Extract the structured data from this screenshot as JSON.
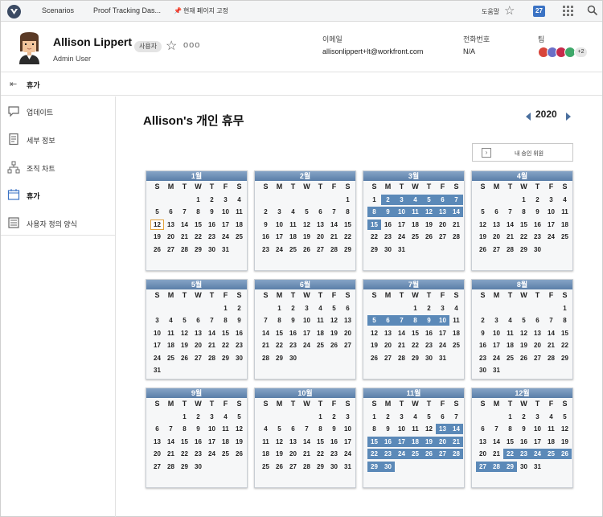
{
  "topbar": {
    "nav": [
      "Scenarios",
      "Proof Tracking Das...",
      "현재 페이지 고정"
    ],
    "help": "도움말",
    "badge": "27"
  },
  "user": {
    "name": "Allison Lippert",
    "role": "Admin User",
    "tag": "사용자",
    "more": "ooo"
  },
  "fields": [
    {
      "label": "이메일",
      "value": "allisonlippert+lt@workfront.com"
    },
    {
      "label": "전화번호",
      "value": "N/A"
    },
    {
      "label": "팀",
      "value": ""
    }
  ],
  "team": {
    "more": "+2",
    "colors": [
      "#d8453b",
      "#6b6fc7",
      "#c72a4b",
      "#3fa86a"
    ]
  },
  "breadcrumb": {
    "title": "휴가"
  },
  "sidebar": {
    "items": [
      {
        "label": "업데이트",
        "icon": "chat-icon"
      },
      {
        "label": "세부 정보",
        "icon": "document-icon"
      },
      {
        "label": "조직 차트",
        "icon": "org-chart-icon"
      },
      {
        "label": "휴가",
        "icon": "calendar-icon"
      },
      {
        "label": "사용자 정의 양식",
        "icon": "form-icon"
      }
    ]
  },
  "main": {
    "title": "Allison's 개인 휴무",
    "year": "2020",
    "approver": "내 승인 위원"
  },
  "calendar": {
    "dows": [
      "S",
      "M",
      "T",
      "W",
      "T",
      "F",
      "S"
    ],
    "months": [
      {
        "name": "1월",
        "start": 3,
        "days": 31,
        "off": [],
        "today": 12
      },
      {
        "name": "2월",
        "start": 6,
        "days": 29,
        "off": []
      },
      {
        "name": "3월",
        "start": 0,
        "days": 31,
        "off": [
          2,
          3,
          4,
          5,
          6,
          7,
          8,
          9,
          10,
          11,
          12,
          13,
          14,
          15
        ]
      },
      {
        "name": "4월",
        "start": 3,
        "days": 30,
        "off": []
      },
      {
        "name": "5월",
        "start": 5,
        "days": 31,
        "off": []
      },
      {
        "name": "6월",
        "start": 1,
        "days": 30,
        "off": []
      },
      {
        "name": "7월",
        "start": 3,
        "days": 31,
        "off": [
          5,
          6,
          7,
          8,
          9,
          10
        ]
      },
      {
        "name": "8월",
        "start": 6,
        "days": 31,
        "off": []
      },
      {
        "name": "9월",
        "start": 2,
        "days": 30,
        "off": []
      },
      {
        "name": "10월",
        "start": 4,
        "days": 31,
        "off": []
      },
      {
        "name": "11월",
        "start": 0,
        "days": 30,
        "off": [
          13,
          14,
          15,
          16,
          17,
          18,
          19,
          20,
          21,
          22,
          23,
          24,
          25,
          26,
          27,
          28,
          29,
          30
        ]
      },
      {
        "name": "12월",
        "start": 2,
        "days": 31,
        "off": [
          22,
          23,
          24,
          25,
          26,
          27,
          28,
          29
        ]
      }
    ]
  }
}
